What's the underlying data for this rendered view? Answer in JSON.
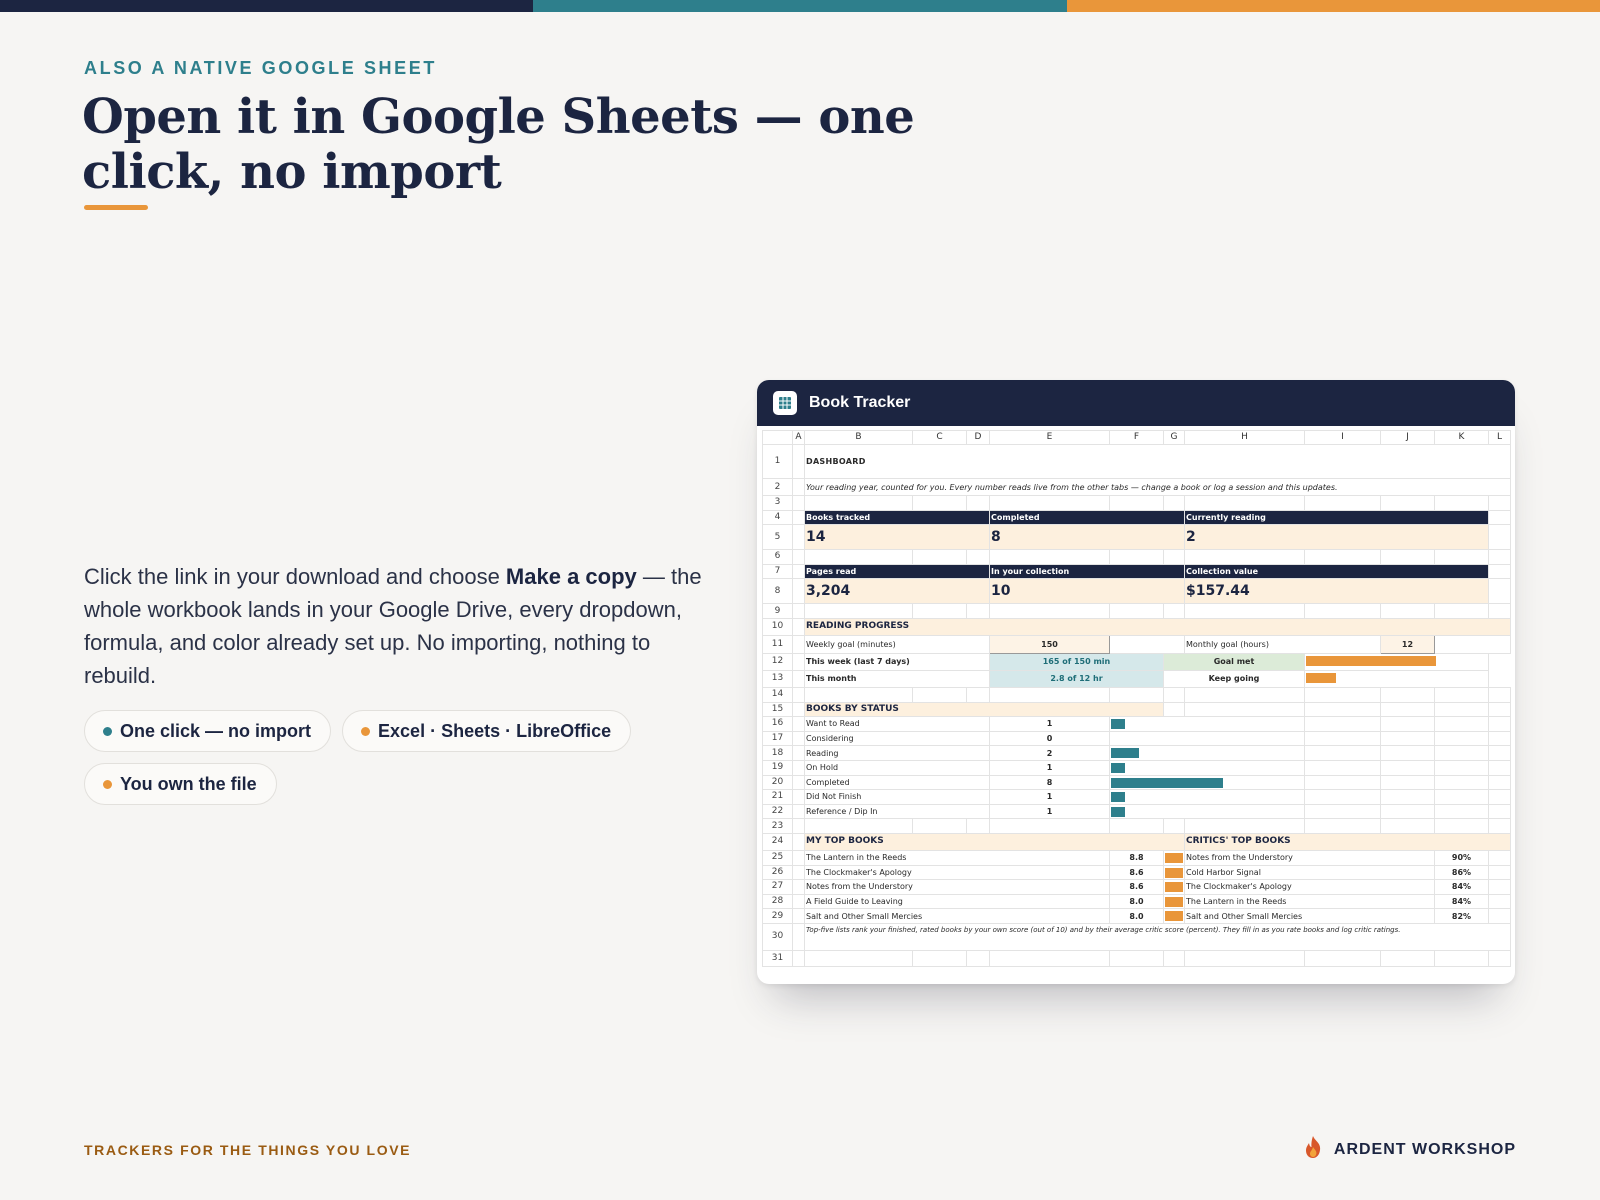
{
  "colors": {
    "navy": "#1c2541",
    "teal": "#2e7f8c",
    "orange": "#e9963a",
    "brown": "#9a5b12"
  },
  "eyebrow": "ALSO A NATIVE GOOGLE SHEET",
  "headline": "Open it in Google Sheets — one click, no import",
  "body": {
    "part1": "Click the link in your download and choose ",
    "bold": "Make a copy",
    "part2": " — the whole workbook lands in your Google Drive, every dropdown, formula, and color already set up. No importing, nothing to rebuild."
  },
  "pills": [
    {
      "label": "One click — no import",
      "dot": "#2e7f8c"
    },
    {
      "label": "Excel · Sheets · LibreOffice",
      "dot": "#e9963a"
    },
    {
      "label": "You own the file",
      "dot": "#e9963a"
    }
  ],
  "footer": {
    "tagline": "TRACKERS FOR THE THINGS YOU LOVE",
    "brand": "ARDENT WORKSHOP",
    "logo_icon": "flame-icon"
  },
  "sheet": {
    "title": "Book Tracker",
    "icon": "spreadsheet-grid-icon",
    "columns": [
      "A",
      "B",
      "C",
      "D",
      "E",
      "F",
      "G",
      "H",
      "I",
      "J",
      "K",
      "L"
    ],
    "dashboard_title": "DASHBOARD",
    "subtitle": "Your reading year, counted for you. Every number reads live from the other tabs — change a book or log a session and this updates.",
    "kpi_row1": [
      {
        "label": "Books tracked",
        "value": "14"
      },
      {
        "label": "Completed",
        "value": "8"
      },
      {
        "label": "Currently reading",
        "value": "2"
      }
    ],
    "kpi_row2": [
      {
        "label": "Pages read",
        "value": "3,204"
      },
      {
        "label": "In your collection",
        "value": "10"
      },
      {
        "label": "Collection value",
        "value": "$157.44"
      }
    ],
    "reading_progress": {
      "title": "READING PROGRESS",
      "weekly_goal_label": "Weekly goal (minutes)",
      "weekly_goal": "150",
      "monthly_goal_label": "Monthly goal (hours)",
      "monthly_goal": "12",
      "week_label": "This week (last 7 days)",
      "week_value": "165 of 150 min",
      "week_status": "Goal met",
      "week_progress": 1.0,
      "month_label": "This month",
      "month_value": "2.8 of 12 hr",
      "month_status": "Keep going",
      "month_progress": 0.233
    },
    "status": {
      "title": "BOOKS BY STATUS",
      "rows": [
        {
          "label": "Want to Read",
          "count": "1",
          "n": 1
        },
        {
          "label": "Considering",
          "count": "0",
          "n": 0
        },
        {
          "label": "Reading",
          "count": "2",
          "n": 2
        },
        {
          "label": "On Hold",
          "count": "1",
          "n": 1
        },
        {
          "label": "Completed",
          "count": "8",
          "n": 8
        },
        {
          "label": "Did Not Finish",
          "count": "1",
          "n": 1
        },
        {
          "label": "Reference / Dip In",
          "count": "1",
          "n": 1
        }
      ]
    },
    "my_top": {
      "title": "MY TOP BOOKS",
      "rows": [
        {
          "title": "The Lantern in the Reeds",
          "score": "8.8"
        },
        {
          "title": "The Clockmaker's Apology",
          "score": "8.6"
        },
        {
          "title": "Notes from the Understory",
          "score": "8.6"
        },
        {
          "title": "A Field Guide to Leaving",
          "score": "8.0"
        },
        {
          "title": "Salt and Other Small Mercies",
          "score": "8.0"
        }
      ]
    },
    "critics_top": {
      "title": "CRITICS' TOP BOOKS",
      "rows": [
        {
          "title": "Notes from the Understory",
          "score": "90%"
        },
        {
          "title": "Cold Harbor Signal",
          "score": "86%"
        },
        {
          "title": "The Clockmaker's Apology",
          "score": "84%"
        },
        {
          "title": "The Lantern in the Reeds",
          "score": "84%"
        },
        {
          "title": "Salt and Other Small Mercies",
          "score": "82%"
        }
      ]
    },
    "footnote": "Top-five lists rank your finished, rated books by your own score (out of 10) and by their average critic score (percent). They fill in as you rate books and log critic ratings."
  }
}
